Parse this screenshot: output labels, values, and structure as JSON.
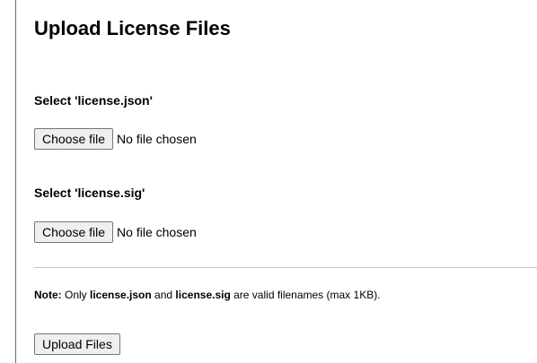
{
  "page": {
    "title": "Upload License Files"
  },
  "json_field": {
    "label": "Select 'license.json'",
    "button_label": "Choose file",
    "status": "No file chosen"
  },
  "sig_field": {
    "label": "Select 'license.sig'",
    "button_label": "Choose file",
    "status": "No file chosen"
  },
  "note": {
    "prefix": "Note:",
    "text_1": " Only ",
    "file_1": "license.json",
    "text_2": " and ",
    "file_2": "license.sig",
    "text_3": " are valid filenames (max 1KB)."
  },
  "actions": {
    "upload_label": "Upload Files"
  }
}
